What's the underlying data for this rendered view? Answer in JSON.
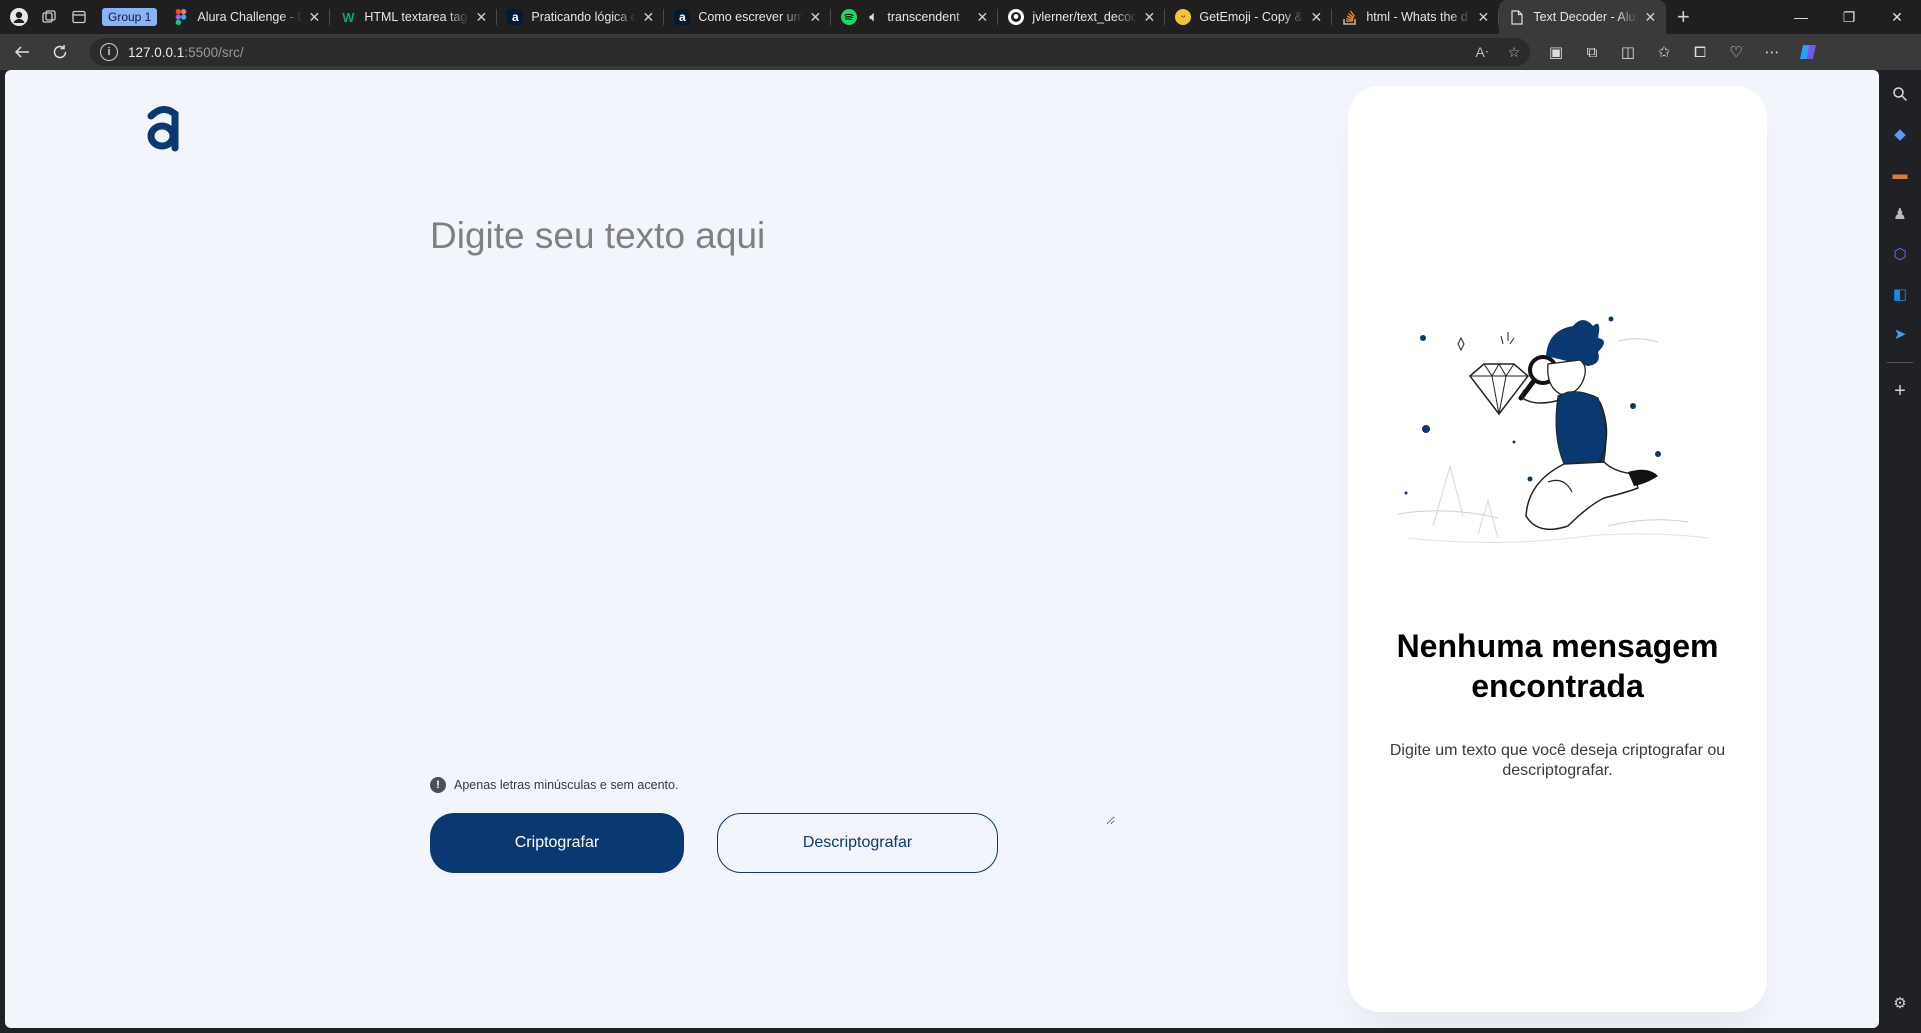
{
  "browser": {
    "group_label": "Group 1",
    "tabs": [
      {
        "title": "Alura Challenge - D",
        "favicon": "figma-icon"
      },
      {
        "title": "HTML textarea tag",
        "favicon": "w3schools-icon"
      },
      {
        "title": "Praticando lógica d",
        "favicon": "alura-icon"
      },
      {
        "title": "Como escrever um",
        "favicon": "alura-icon"
      },
      {
        "title": "transcendent",
        "favicon": "spotify-icon"
      },
      {
        "title": "jvlerner/text_decod",
        "favicon": "github-icon"
      },
      {
        "title": "GetEmoji - Copy &",
        "favicon": "emoji-icon"
      },
      {
        "title": "html - Whats the d",
        "favicon": "stackoverflow-icon"
      },
      {
        "title": "Text Decoder - Alur",
        "favicon": "page-icon",
        "active": true
      }
    ],
    "url_host": "127.0.0.1",
    "url_rest": ":5500/src/"
  },
  "page": {
    "textarea_placeholder": "Digite seu texto aqui",
    "hint": "Apenas letras minúsculas e sem acento.",
    "encrypt_label": "Criptografar",
    "decrypt_label": "Descriptografar",
    "output": {
      "title": "Nenhuma mensagem encontrada",
      "description": "Digite um texto que você deseja criptografar ou descriptografar."
    }
  },
  "colors": {
    "primary": "#0a3871",
    "page_bg": "#f3f5fc",
    "card_bg": "#ffffff"
  }
}
